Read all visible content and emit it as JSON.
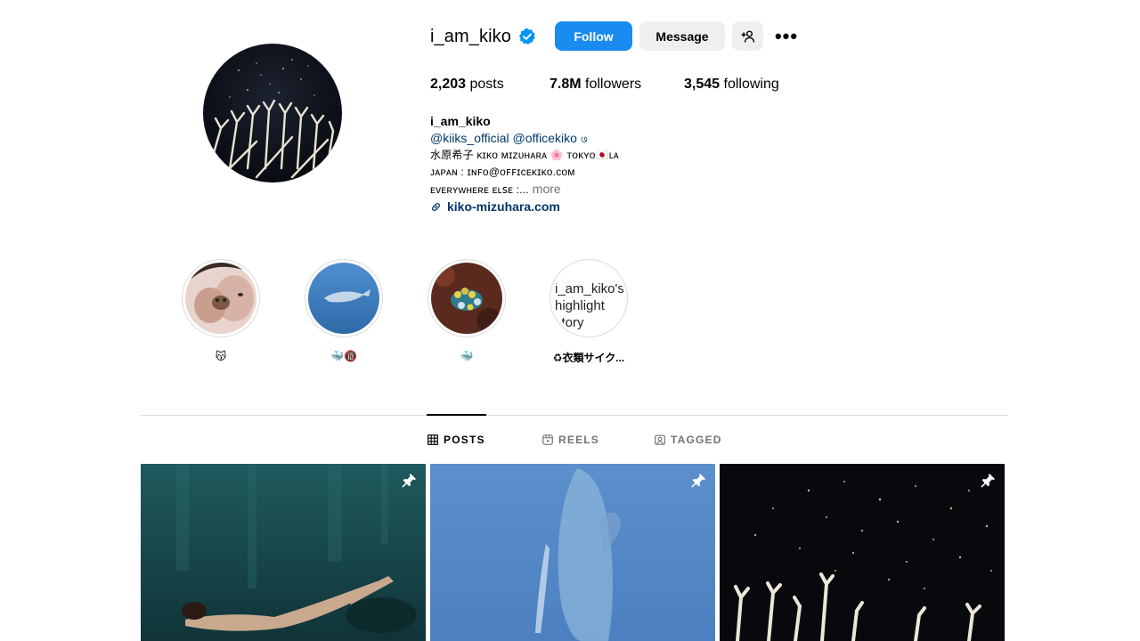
{
  "profile": {
    "username": "i_am_kiko",
    "verified_icon": "verified-badge-icon",
    "follow_label": "Follow",
    "message_label": "Message",
    "more_label": "•••",
    "accent": "#0095f6"
  },
  "stats": {
    "posts_value": "2,203",
    "posts_label": " posts",
    "followers_value": "7.8M",
    "followers_label": " followers",
    "following_value": "3,545",
    "following_label": " following"
  },
  "bio": {
    "name": "i_am_kiko",
    "tags": "@kiiks_official @officekiko ဖ",
    "line1": "水原希子 ᴋɪᴋᴏ ᴍɪᴢᴜʜᴀʀᴀ 🌸 ᴛᴏᴋʏᴏ🇯🇵ʟᴀ",
    "line2": "ᴊᴀᴘᴀɴ : ɪɴꜰᴏ@ᴏꜰꜰɪᴄᴇᴋɪᴋᴏ.ᴄᴏᴍ",
    "line3": "ᴇᴠᴇʀʏᴡʜᴇʀᴇ ᴇʟꜱᴇ :...",
    "more": " more",
    "link": "kiko-mizuhara.com"
  },
  "highlights": [
    {
      "label": "😽"
    },
    {
      "label": "🐳🔞"
    },
    {
      "label": "🐳"
    },
    {
      "label": "♻衣類サイク...",
      "alt_text": "i_am_kiko's highlight story"
    }
  ],
  "tabs": [
    {
      "label": "POSTS",
      "icon": "grid-icon",
      "active": true
    },
    {
      "label": "REELS",
      "icon": "reels-icon",
      "active": false
    },
    {
      "label": "TAGGED",
      "icon": "tagged-icon",
      "active": false
    }
  ],
  "posts": [
    {
      "pinned": true,
      "icon": "pin-icon"
    },
    {
      "pinned": true,
      "icon": "pin-icon"
    },
    {
      "pinned": true,
      "icon": "pin-icon"
    }
  ]
}
